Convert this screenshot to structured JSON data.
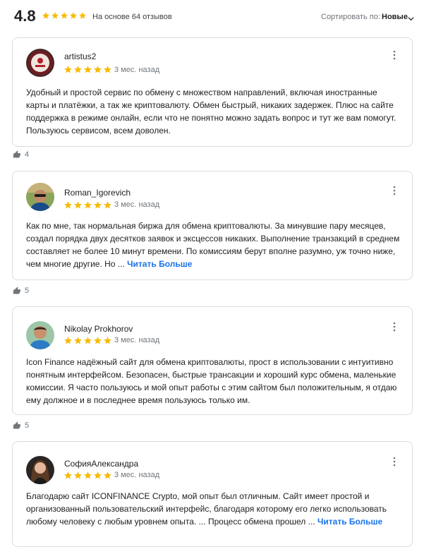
{
  "header": {
    "rating": "4.8",
    "stars": 5,
    "based_on": "На основе 64 отзывов",
    "sort_label": "Сортировать по:",
    "sort_value": "Новые"
  },
  "colors": {
    "star": "#f6bb06",
    "link": "#1a73e8",
    "border": "#dadce0",
    "muted": "#70757a"
  },
  "icons": {
    "star": "star-icon",
    "more": "more-vertical-icon",
    "like": "thumbs-up-icon",
    "sort": "chevron-down-icon"
  },
  "reviews": [
    {
      "author": "artistus2",
      "stars": 5,
      "date": "3 мес. назад",
      "text": "Удобный и простой сервис по обмену с множеством направлений, включая иностранные карты и платёжки, а так же криптовалюту. Обмен быстрый, никаких задержек. Плюс на сайте поддержка в режиме онлайн, если что не понятно можно задать вопрос и тут же вам помогут. Пользуюсь сервисом, всем доволен.",
      "read_more": "",
      "likes": "4"
    },
    {
      "author": "Roman_Igorevich",
      "stars": 5,
      "date": "3 мес. назад",
      "text": "Как по мне, так нормальная биржа для обмена криптовалюты. За минувшие пару месяцев, создал порядка двух десятков заявок и эксцессов никаких. Выполнение транзакций в среднем составляет не более 10 минут времени. По комиссиям берут вполне разумно, уж точно ниже, чем многие другие. Но ... ",
      "read_more": "Читать Больше",
      "likes": "5"
    },
    {
      "author": "Nikolay Prokhorov",
      "stars": 5,
      "date": "3 мес. назад",
      "text": "Icon Finance надёжный сайт для обмена криптовалюты, прост в использовании с интуитивно понятным интерфейсом. Безопасен, быстрые трансакции и хороший курс обмена, маленькие комиссии. Я часто пользуюсь и мой опыт работы с этим сайтом был положительным, я отдаю ему должное и в последнее время пользуюсь только им.",
      "read_more": "",
      "likes": "5"
    },
    {
      "author": "СофияАлександра",
      "stars": 5,
      "date": "3 мес. назад",
      "text": "Благодарю сайт ICONFINANCE Crypto, мой опыт был отличным.  Сайт имеет простой и организованный пользовательский интерфейс, благодаря которому его легко использовать любому человеку с любым уровнем опыта. ... Процесс обмена прошел ... ",
      "read_more": "Читать Больше",
      "likes": ""
    }
  ]
}
